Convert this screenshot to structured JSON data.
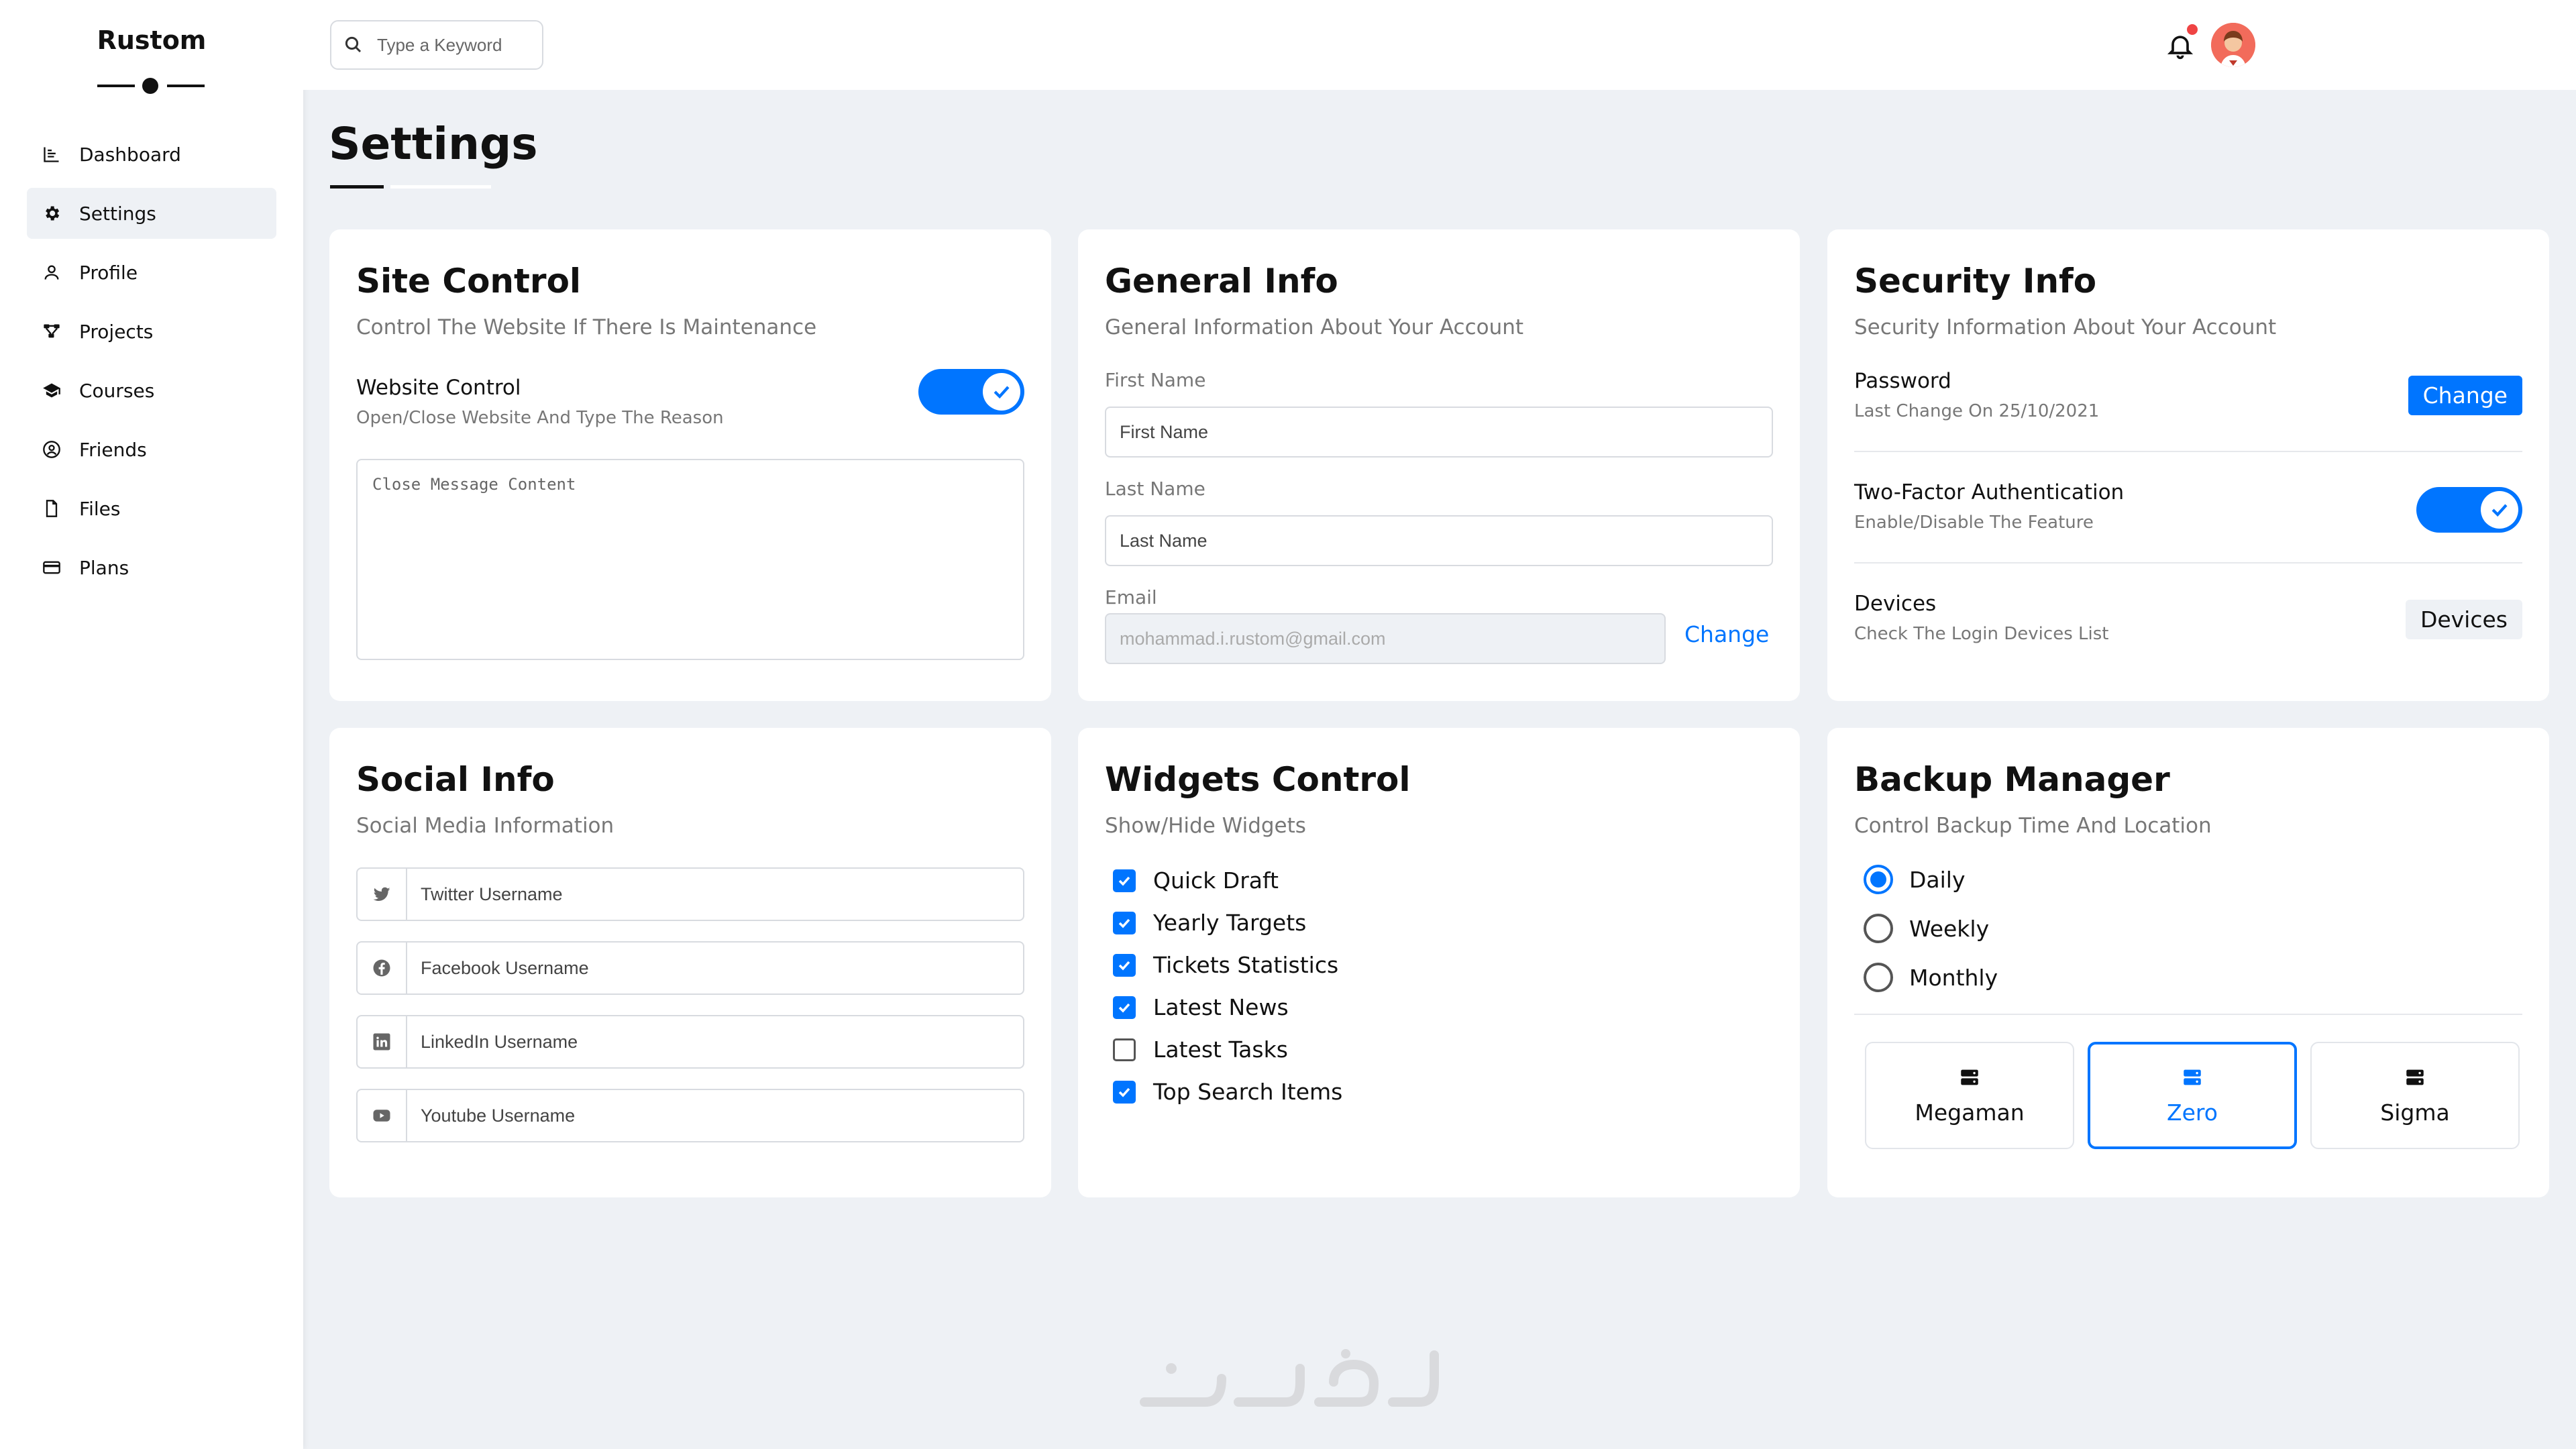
{
  "app": {
    "logo": "Rustom"
  },
  "sidebar": {
    "items": [
      {
        "label": "Dashboard",
        "icon": "chart-icon"
      },
      {
        "label": "Settings",
        "icon": "gear-icon",
        "active": true
      },
      {
        "label": "Profile",
        "icon": "user-icon"
      },
      {
        "label": "Projects",
        "icon": "project-icon"
      },
      {
        "label": "Courses",
        "icon": "graduation-cap-icon"
      },
      {
        "label": "Friends",
        "icon": "user-circle-icon"
      },
      {
        "label": "Files",
        "icon": "file-icon"
      },
      {
        "label": "Plans",
        "icon": "credit-card-icon"
      }
    ]
  },
  "header": {
    "search_placeholder": "Type a Keyword",
    "notification_indicator": true
  },
  "page": {
    "title": "Settings"
  },
  "site_control": {
    "title": "Site Control",
    "subtitle": "Control The Website If There Is Maintenance",
    "toggle_title": "Website Control",
    "toggle_sub": "Open/Close Website And Type The Reason",
    "toggle_on": true,
    "message_placeholder": "Close Message Content"
  },
  "general_info": {
    "title": "General Info",
    "subtitle": "General Information About Your Account",
    "first_name_label": "First Name",
    "first_name_placeholder": "First Name",
    "last_name_label": "Last Name",
    "last_name_placeholder": "Last Name",
    "email_label": "Email",
    "email_placeholder": "mohammad.i.rustom@gmail.com",
    "email_change": "Change"
  },
  "security_info": {
    "title": "Security Info",
    "subtitle": "Security Information About Your Account",
    "password_title": "Password",
    "password_sub": "Last Change On 25/10/2021",
    "password_button": "Change",
    "twofa_title": "Two-Factor Authentication",
    "twofa_sub": "Enable/Disable The Feature",
    "twofa_on": true,
    "devices_title": "Devices",
    "devices_sub": "Check The Login Devices List",
    "devices_button": "Devices"
  },
  "social_info": {
    "title": "Social Info",
    "subtitle": "Social Media Information",
    "fields": [
      {
        "icon": "twitter-icon",
        "placeholder": "Twitter Username"
      },
      {
        "icon": "facebook-icon",
        "placeholder": "Facebook Username"
      },
      {
        "icon": "linkedin-icon",
        "placeholder": "LinkedIn Username"
      },
      {
        "icon": "youtube-icon",
        "placeholder": "Youtube Username"
      }
    ]
  },
  "widgets_control": {
    "title": "Widgets Control",
    "subtitle": "Show/Hide Widgets",
    "items": [
      {
        "label": "Quick Draft",
        "checked": true
      },
      {
        "label": "Yearly Targets",
        "checked": true
      },
      {
        "label": "Tickets Statistics",
        "checked": true
      },
      {
        "label": "Latest News",
        "checked": true
      },
      {
        "label": "Latest Tasks",
        "checked": false
      },
      {
        "label": "Top Search Items",
        "checked": true
      }
    ]
  },
  "backup_manager": {
    "title": "Backup Manager",
    "subtitle": "Control Backup Time And Location",
    "frequency": [
      {
        "label": "Daily",
        "selected": true
      },
      {
        "label": "Weekly",
        "selected": false
      },
      {
        "label": "Monthly",
        "selected": false
      }
    ],
    "servers": [
      {
        "label": "Megaman",
        "selected": false
      },
      {
        "label": "Zero",
        "selected": true
      },
      {
        "label": "Sigma",
        "selected": false
      }
    ]
  },
  "colors": {
    "accent": "#0075ff",
    "background": "#eef1f5",
    "notification": "#ef4444"
  }
}
